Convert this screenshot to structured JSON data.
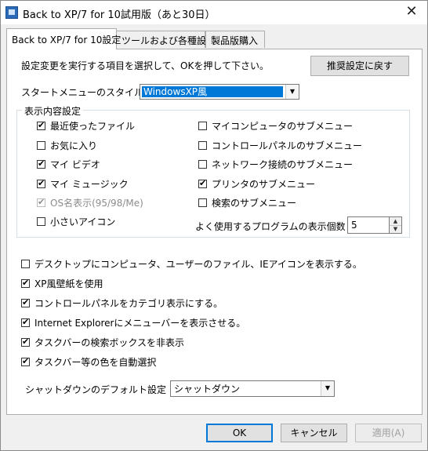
{
  "window": {
    "title": "Back to XP/7 for 10試用版（あと30日）",
    "close_glyph": "✕"
  },
  "tabs": [
    {
      "label": "Back to XP/7 for 10設定"
    },
    {
      "label": "ツールおよび各種設定"
    },
    {
      "label": "製品版購入"
    }
  ],
  "panel": {
    "instruction": "設定変更を実行する項目を選択して、OKを押して下さい。",
    "reset_button": "推奨設定に戻す",
    "start_menu_style_label": "スタートメニューのスタイル",
    "start_menu_style_value": "WindowsXP風",
    "display_group_title": "表示内容設定",
    "left_checks": [
      {
        "label": "最近使ったファイル",
        "checked": true,
        "disabled": false
      },
      {
        "label": "お気に入り",
        "checked": false,
        "disabled": false
      },
      {
        "label": "マイ ビデオ",
        "checked": true,
        "disabled": false
      },
      {
        "label": "マイ ミュージック",
        "checked": true,
        "disabled": false
      },
      {
        "label": "OS名表示(95/98/Me)",
        "checked": true,
        "disabled": true
      },
      {
        "label": "小さいアイコン",
        "checked": false,
        "disabled": false
      }
    ],
    "right_checks": [
      {
        "label": "マイコンピュータのサブメニュー",
        "checked": false
      },
      {
        "label": "コントロールパネルのサブメニュー",
        "checked": false
      },
      {
        "label": "ネットワーク接続のサブメニュー",
        "checked": false
      },
      {
        "label": "プリンタのサブメニュー",
        "checked": true
      },
      {
        "label": "検索のサブメニュー",
        "checked": false
      }
    ],
    "program_count_label": "よく使用するプログラムの表示個数",
    "program_count_value": "5",
    "bottom_checks": [
      {
        "label": "デスクトップにコンピュータ、ユーザーのファイル、IEアイコンを表示する。",
        "checked": false
      },
      {
        "label": "XP風壁紙を使用",
        "checked": true
      },
      {
        "label": "コントロールパネルをカテゴリ表示にする。",
        "checked": true
      },
      {
        "label": "Internet Explorerにメニューバーを表示させる。",
        "checked": true
      },
      {
        "label": "タスクバーの検索ボックスを非表示",
        "checked": true
      },
      {
        "label": "タスクバー等の色を自動選択",
        "checked": true
      }
    ],
    "shutdown_label": "シャットダウンのデフォルト設定",
    "shutdown_value": "シャットダウン"
  },
  "footer": {
    "ok": "OK",
    "cancel": "キャンセル",
    "apply": "適用(A)"
  },
  "colors": {
    "accent": "#0078d7",
    "dialog_bg": "#f0f0f0",
    "panel_bg": "#ffffff"
  }
}
